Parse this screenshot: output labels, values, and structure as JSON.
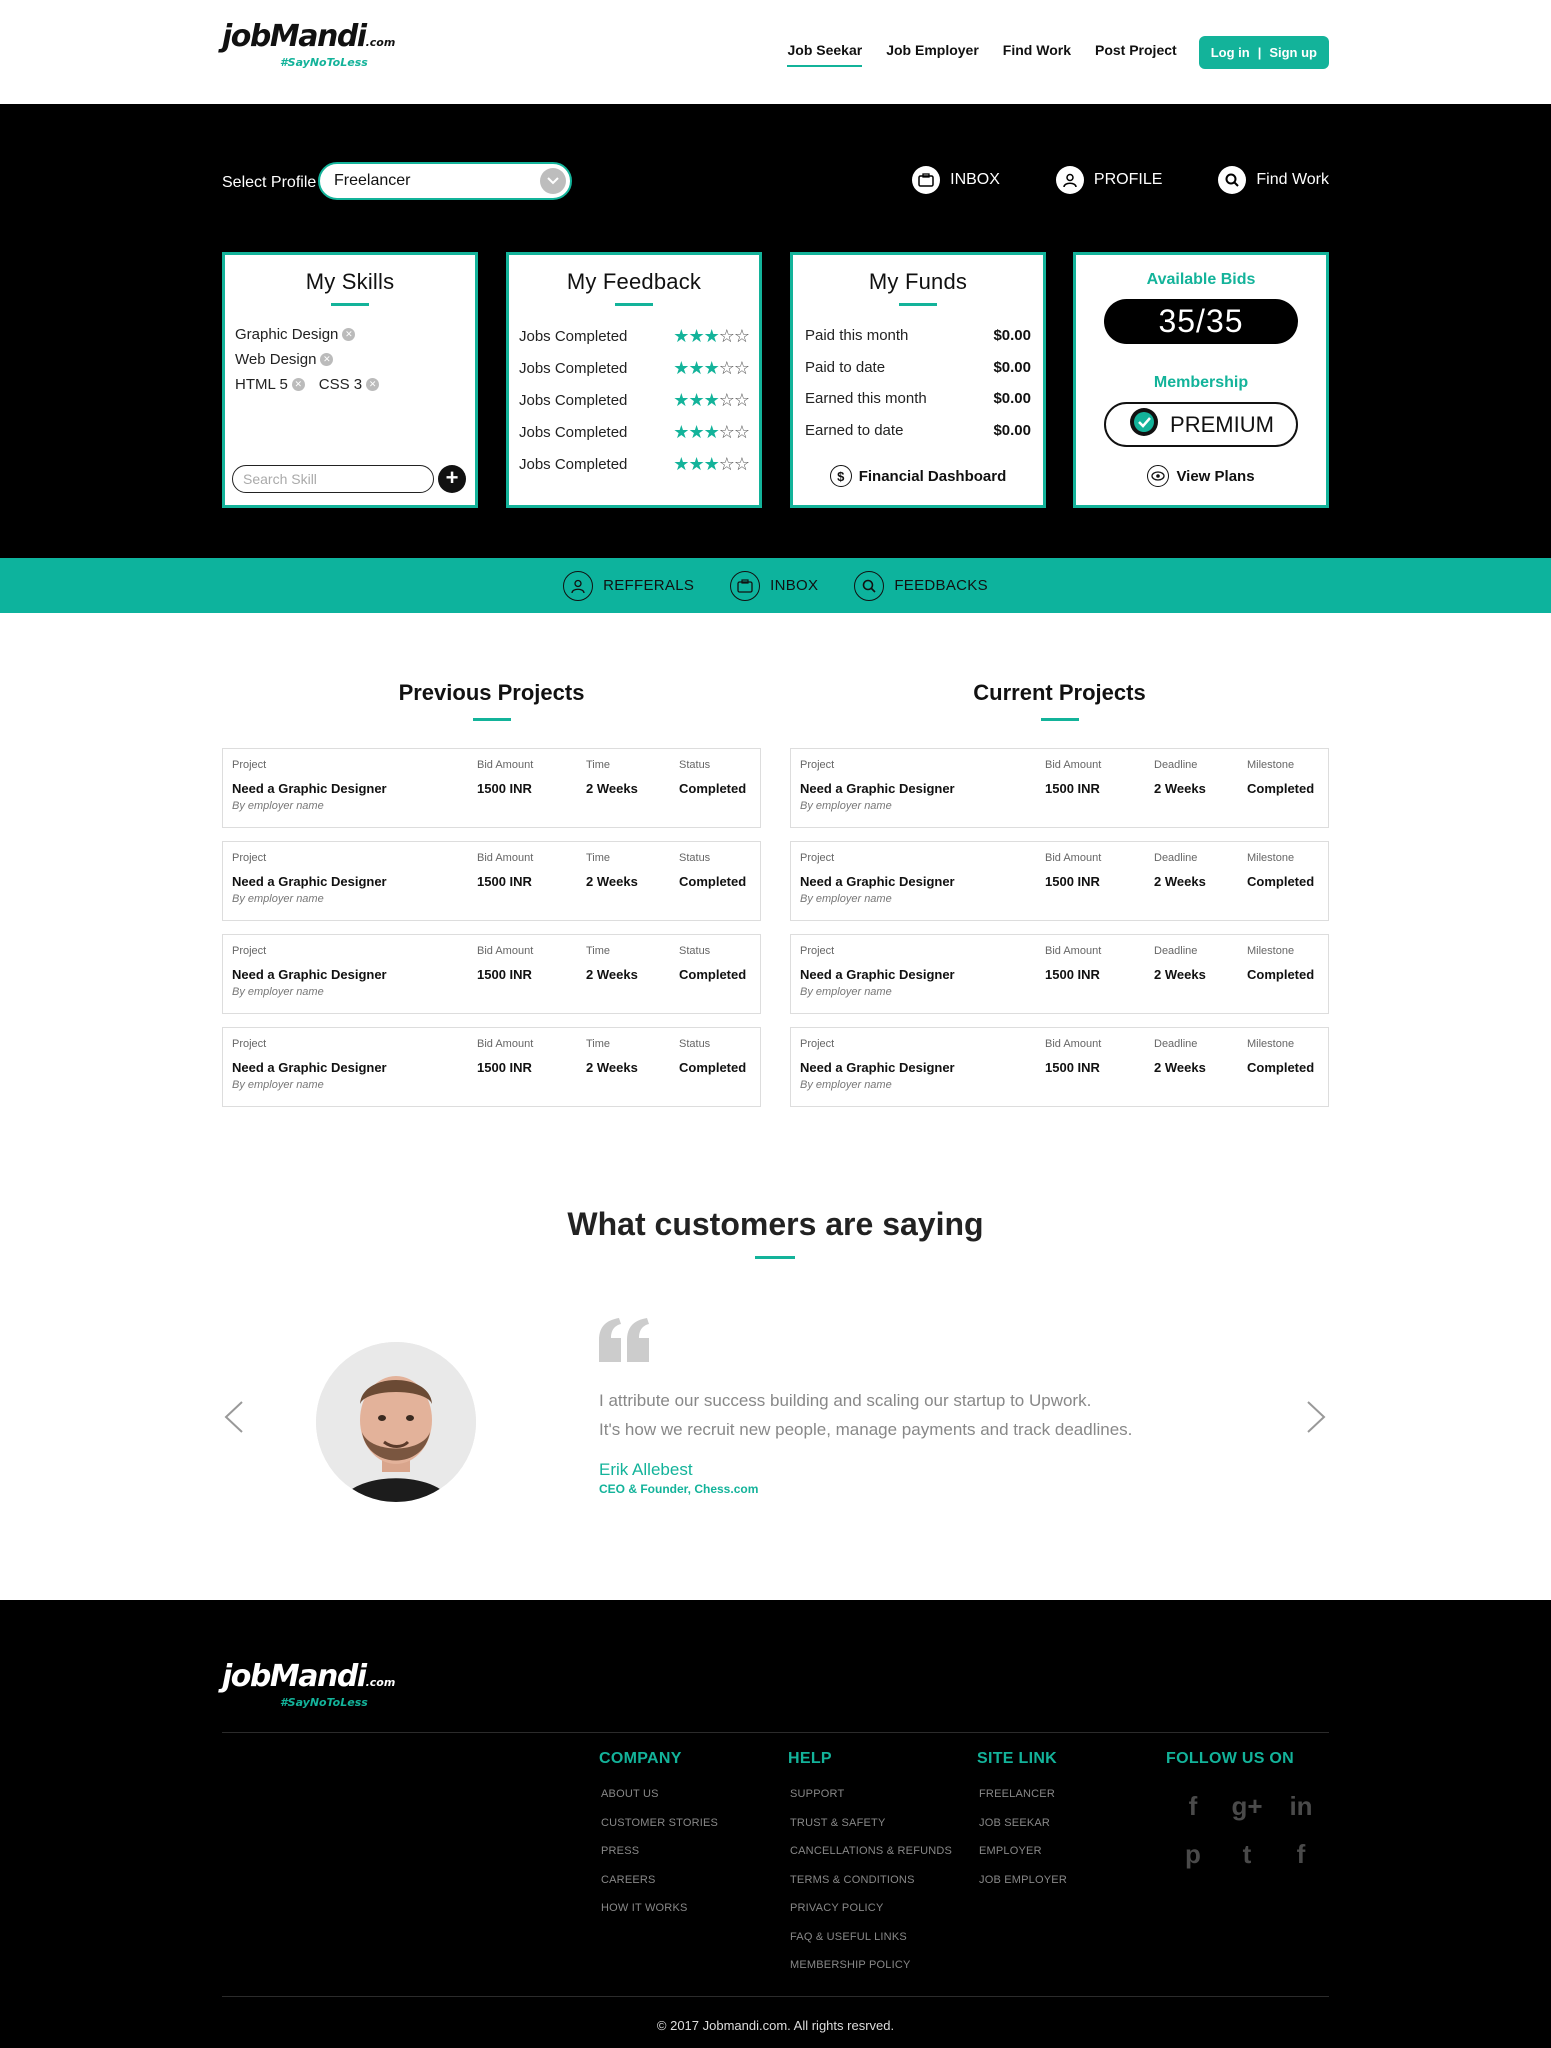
{
  "header": {
    "logo_text": "jobMandi",
    "logo_suffix": ".com",
    "logo_tag": "#SayNoToLess",
    "nav": [
      "Job Seekar",
      "Job Employer",
      "Find Work",
      "Post Project"
    ],
    "login": "Log in",
    "signup": "Sign up"
  },
  "dashboard": {
    "select_label": "Select Profile",
    "select_value": "Freelancer",
    "links": [
      "INBOX",
      "PROFILE",
      "Find Work"
    ],
    "skills": {
      "title": "My Skills",
      "items": [
        "Graphic Design",
        "Web Design",
        "HTML 5",
        "CSS 3"
      ],
      "search_placeholder": "Search Skill"
    },
    "feedback": {
      "title": "My Feedback",
      "rows": [
        {
          "label": "Jobs Completed",
          "rating": 3,
          "max": 5
        },
        {
          "label": "Jobs Completed",
          "rating": 3,
          "max": 5
        },
        {
          "label": "Jobs Completed",
          "rating": 3,
          "max": 5
        },
        {
          "label": "Jobs Completed",
          "rating": 3,
          "max": 5
        },
        {
          "label": "Jobs Completed",
          "rating": 3,
          "max": 5
        }
      ]
    },
    "funds": {
      "title": "My Funds",
      "rows": [
        {
          "label": "Paid this month",
          "value": "$0.00"
        },
        {
          "label": "Paid to date",
          "value": "$0.00"
        },
        {
          "label": "Earned this month",
          "value": "$0.00"
        },
        {
          "label": "Earned to date",
          "value": "$0.00"
        }
      ],
      "link": "Financial Dashboard"
    },
    "bids": {
      "title": "Available Bids",
      "value": "35/35",
      "membership_title": "Membership",
      "membership_value": "PREMIUM",
      "link": "View Plans"
    }
  },
  "strip": [
    "REFFERALS",
    "INBOX",
    "FEEDBACKS"
  ],
  "previous_projects": {
    "title": "Previous Projects",
    "headers": [
      "Project",
      "Bid Amount",
      "Time",
      "Status"
    ],
    "rows": [
      {
        "project": "Need a Graphic Designer",
        "by": "By employer name",
        "bid": "1500 INR",
        "time": "2 Weeks",
        "status": "Completed"
      },
      {
        "project": "Need a Graphic Designer",
        "by": "By employer name",
        "bid": "1500 INR",
        "time": "2 Weeks",
        "status": "Completed"
      },
      {
        "project": "Need a Graphic Designer",
        "by": "By employer name",
        "bid": "1500 INR",
        "time": "2 Weeks",
        "status": "Completed"
      },
      {
        "project": "Need a Graphic Designer",
        "by": "By employer name",
        "bid": "1500 INR",
        "time": "2 Weeks",
        "status": "Completed"
      }
    ]
  },
  "current_projects": {
    "title": "Current Projects",
    "headers": [
      "Project",
      "Bid Amount",
      "Deadline",
      "Milestone"
    ],
    "rows": [
      {
        "project": "Need a Graphic Designer",
        "by": "By employer name",
        "bid": "1500 INR",
        "time": "2 Weeks",
        "status": "Completed"
      },
      {
        "project": "Need a Graphic Designer",
        "by": "By employer name",
        "bid": "1500 INR",
        "time": "2 Weeks",
        "status": "Completed"
      },
      {
        "project": "Need a Graphic Designer",
        "by": "By employer name",
        "bid": "1500 INR",
        "time": "2 Weeks",
        "status": "Completed"
      },
      {
        "project": "Need a Graphic Designer",
        "by": "By employer name",
        "bid": "1500 INR",
        "time": "2 Weeks",
        "status": "Completed"
      }
    ]
  },
  "testimonials": {
    "title": "What customers are saying",
    "quote_line1": "I attribute our success building and scaling our startup to Upwork.",
    "quote_line2": "It's how we recruit new people, manage payments and track deadlines.",
    "name": "Erik Allebest",
    "role": "CEO & Founder, Chess.com"
  },
  "footer": {
    "columns": [
      {
        "title": "COMPANY",
        "items": [
          "ABOUT US",
          "CUSTOMER STORIES",
          "PRESS",
          "CAREERS",
          "HOW IT WORKS"
        ]
      },
      {
        "title": "HELP",
        "items": [
          "SUPPORT",
          "TRUST & SAFETY",
          "CANCELLATIONS & REFUNDS",
          "TERMS & CONDITIONS",
          "PRIVACY POLICY",
          "FAQ & USEFUL LINKS",
          "MEMBERSHIP POLICY"
        ]
      },
      {
        "title": "SITE LINK",
        "items": [
          "FREELANCER",
          "JOB SEEKAR",
          "EMPLOYER",
          "JOB EMPLOYER"
        ]
      }
    ],
    "follow_title": "FOLLOW US ON",
    "social": [
      {
        "icon": "facebook-icon",
        "glyph": "f"
      },
      {
        "icon": "google-plus-icon",
        "glyph": "g+"
      },
      {
        "icon": "linkedin-icon",
        "glyph": "in"
      },
      {
        "icon": "pinterest-icon",
        "glyph": "p"
      },
      {
        "icon": "twitter-icon",
        "glyph": "t"
      },
      {
        "icon": "facebook-icon",
        "glyph": "f"
      }
    ],
    "copyright": "© 2017 Jobmandi.com. All rights resrved."
  },
  "colors": {
    "accent": "#13b39a",
    "dark": "#000000"
  }
}
